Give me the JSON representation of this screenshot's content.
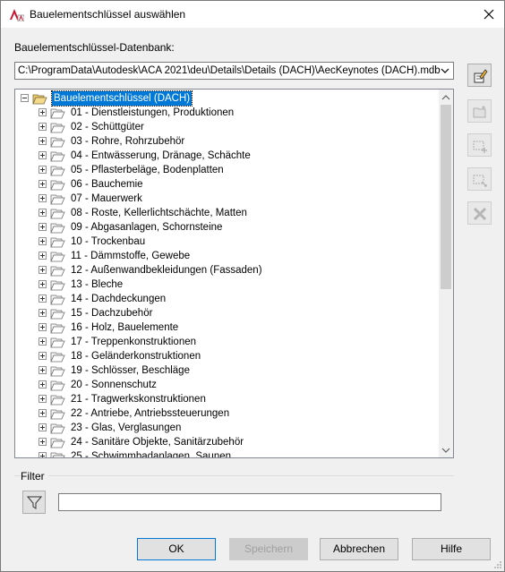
{
  "window": {
    "title": "Bauelementschlüssel auswählen",
    "app_icon": "autocad-architecture-icon",
    "close_icon": "close-icon"
  },
  "database": {
    "label": "Bauelementschlüssel-Datenbank:",
    "path": "C:\\ProgramData\\Autodesk\\ACA 2021\\deu\\Details\\Details (DACH)\\AecKeynotes (DACH).mdb"
  },
  "tree": {
    "root": "Bauelementschlüssel (DACH)",
    "items": [
      "01 - Dienstleistungen, Produktionen",
      "02 - Schüttgüter",
      "03 - Rohre, Rohrzubehör",
      "04 - Entwässerung, Dränage, Schächte",
      "05 - Pflasterbeläge, Bodenplatten",
      "06 - Bauchemie",
      "07 - Mauerwerk",
      "08 - Roste, Kellerlichtschächte, Matten",
      "09 - Abgasanlagen, Schornsteine",
      "10 - Trockenbau",
      "11 - Dämmstoffe, Gewebe",
      "12 - Außenwandbekleidungen (Fassaden)",
      "13 - Bleche",
      "14 - Dachdeckungen",
      "15 - Dachzubehör",
      "16 - Holz, Bauelemente",
      "17 - Treppenkonstruktionen",
      "18 - Geländerkonstruktionen",
      "19 - Schlösser, Beschläge",
      "20 - Sonnenschutz",
      "21 - Tragwerkskonstruktionen",
      "22 - Antriebe, Antriebssteuerungen",
      "23 - Glas, Verglasungen",
      "24 - Sanitäre Objekte, Sanitärzubehör",
      "25 - Schwimmbadanlagen, Saunen"
    ]
  },
  "side_toolbar": [
    {
      "icon": "edit-database-icon",
      "enabled": true
    },
    {
      "icon": "new-folder-icon",
      "enabled": false
    },
    {
      "icon": "add-keynote-icon",
      "enabled": false
    },
    {
      "icon": "edit-keynote-icon",
      "enabled": false
    },
    {
      "icon": "delete-icon",
      "enabled": false
    }
  ],
  "filter": {
    "label": "Filter",
    "icon": "filter-icon",
    "value": ""
  },
  "buttons": {
    "ok": "OK",
    "save": "Speichern",
    "cancel": "Abbrechen",
    "help": "Hilfe"
  },
  "colors": {
    "selection": "#0078d7",
    "folder": "#e8c96b"
  }
}
